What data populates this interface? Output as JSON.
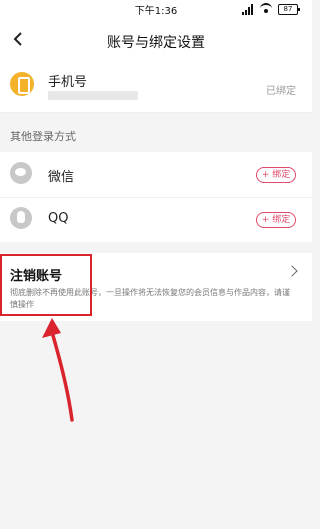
{
  "status": {
    "time": "下午1:36",
    "battery": "87"
  },
  "header": {
    "title": "账号与绑定设置"
  },
  "phone": {
    "label": "手机号",
    "status": "已绑定"
  },
  "other_login": {
    "section_label": "其他登录方式",
    "items": [
      {
        "label": "微信",
        "action": "+ 绑定"
      },
      {
        "label": "QQ",
        "action": "+ 绑定"
      }
    ]
  },
  "cancel": {
    "title": "注销账号",
    "description": "彻底删除不再使用此账号，一旦操作将无法恢复您的会员信息与作品内容，请谨慎操作"
  },
  "colors": {
    "accent": "#e04a6b",
    "highlight": "#d9232d",
    "phone_icon": "#f3b229"
  }
}
